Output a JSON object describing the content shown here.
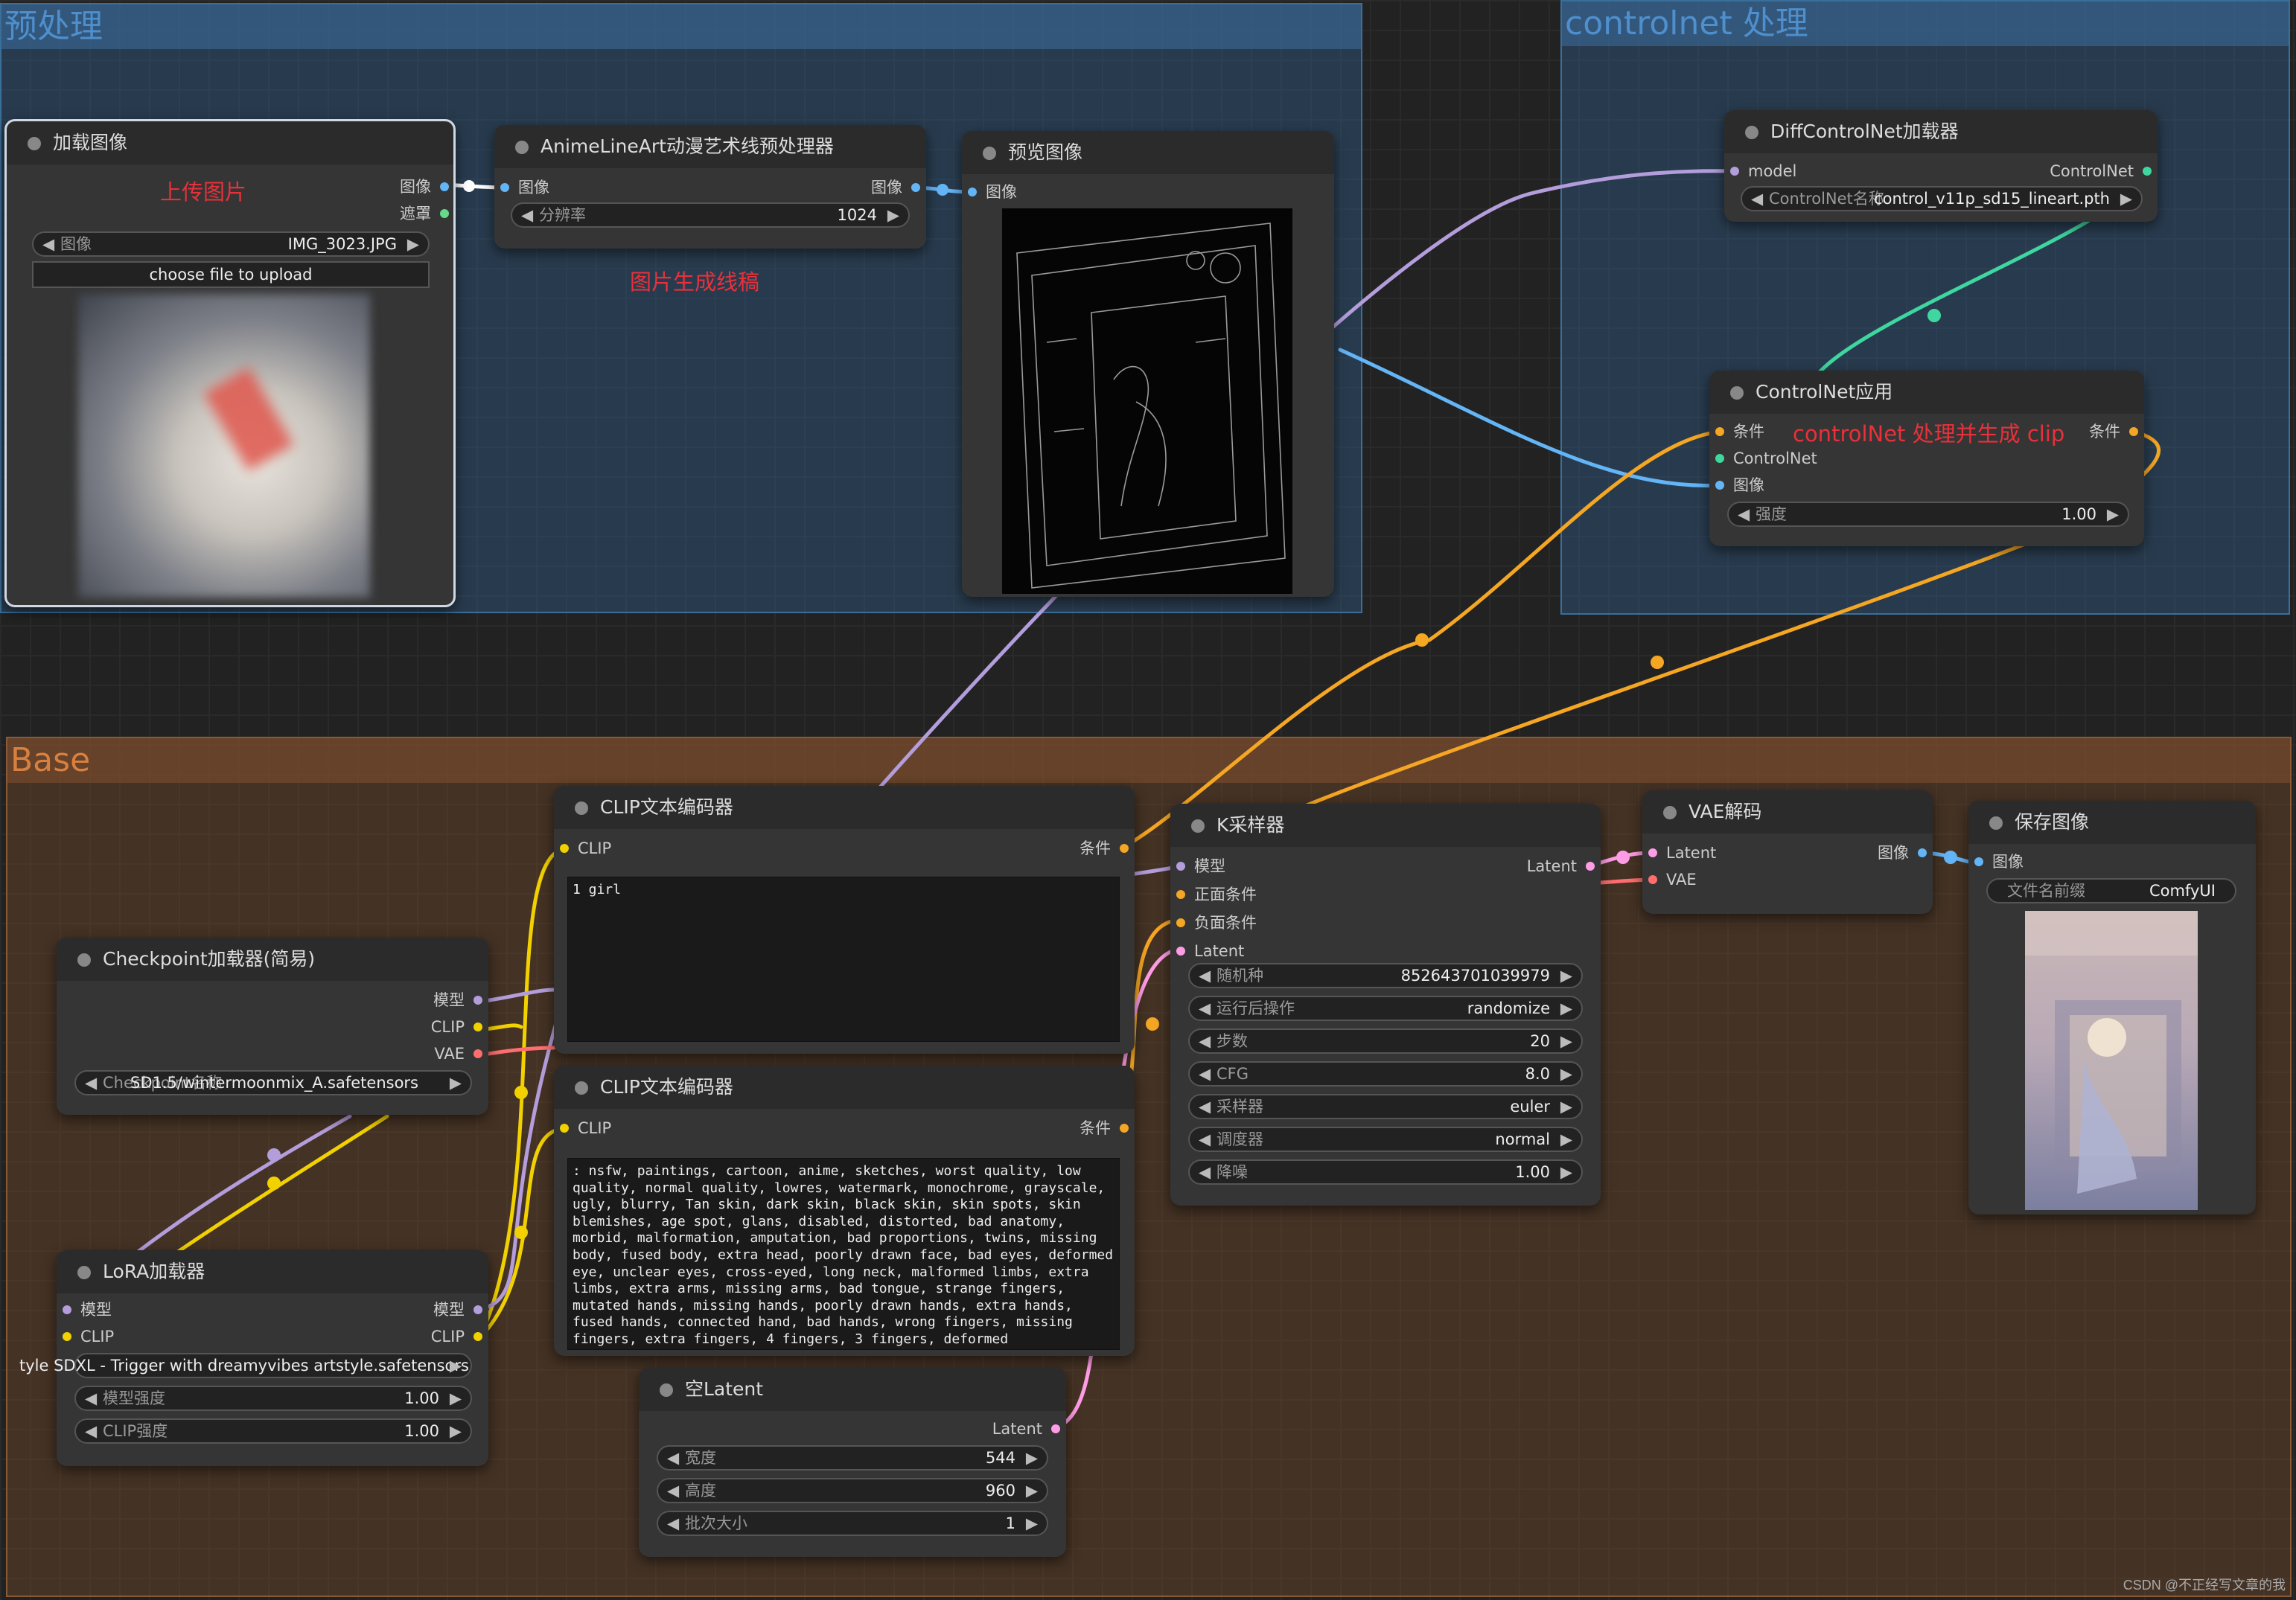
{
  "colors": {
    "clip": "#f2d100",
    "model": "#b39ddb",
    "conditioning": "#f5a623",
    "image": "#64b5f6",
    "latent": "#ff9ce6",
    "vae": "#ff6e6e",
    "controlnet": "#3fd6a0",
    "mask": "#66d98c",
    "red": "#e8313a"
  },
  "groups": {
    "preprocess": "预处理",
    "controlnet": "controlnet 处理",
    "base": "Base"
  },
  "load_image": {
    "title": "加载图像",
    "note": "上传图片",
    "out_image": "图像",
    "out_mask": "遮罩",
    "widget_label": "图像",
    "widget_value": "IMG_3023.JPG",
    "upload": "choose file to upload"
  },
  "anime": {
    "title": "AnimeLineArt动漫艺术线预处理器",
    "in_image": "图像",
    "out_image": "图像",
    "widget_label": "分辨率",
    "widget_value": "1024",
    "note": "图片生成线稿"
  },
  "preview": {
    "title": "预览图像",
    "in_image": "图像"
  },
  "diffcn": {
    "title": "DiffControlNet加载器",
    "in_model": "model",
    "out_cn": "ControlNet",
    "widget_label": "ControlNet名称",
    "widget_value": "control_v11p_sd15_lineart.pth"
  },
  "cnapply": {
    "title": "ControlNet应用",
    "in_cond": "条件",
    "in_cn": "ControlNet",
    "in_image": "图像",
    "out_cond": "条件",
    "note": "controlNet 处理并生成 clip",
    "widget_label": "强度",
    "widget_value": "1.00"
  },
  "clip1": {
    "title": "CLIP文本编码器",
    "in_clip": "CLIP",
    "out_cond": "条件",
    "text": "1 girl"
  },
  "clip2": {
    "title": "CLIP文本编码器",
    "in_clip": "CLIP",
    "out_cond": "条件",
    "text": ": nsfw, paintings, cartoon, anime, sketches, worst quality, low quality, normal quality, lowres, watermark, monochrome, grayscale, ugly, blurry, Tan skin, dark skin, black skin, skin spots, skin blemishes, age spot, glans, disabled, distorted, bad anatomy, morbid, malformation, amputation, bad proportions, twins, missing body, fused body, extra head, poorly drawn face, bad eyes, deformed eye, unclear eyes, cross-eyed, long neck, malformed limbs, extra limbs, extra arms, missing arms, bad tongue, strange fingers, mutated hands, missing hands, poorly drawn hands, extra hands, fused hands, connected hand, bad hands, wrong fingers, missing fingers, extra fingers, 4 fingers, 3 fingers, deformed"
  },
  "checkpoint": {
    "title": "Checkpoint加载器(简易)",
    "out_model": "模型",
    "out_clip": "CLIP",
    "out_vae": "VAE",
    "widget_label": "Checkpoint名称",
    "widget_value": "SD1.5/wintermoonmix_A.safetensors"
  },
  "lora": {
    "title": "LoRA加载器",
    "in_model": "模型",
    "in_clip": "CLIP",
    "out_model": "模型",
    "out_clip": "CLIP",
    "lora_overflow": "tyle SDXL - Trigger with dreamyvibes artstyle.safetensors",
    "w1_label": "模型强度",
    "w1_value": "1.00",
    "w2_label": "CLIP强度",
    "w2_value": "1.00"
  },
  "ksampler": {
    "title": "K采样器",
    "in_model": "模型",
    "in_pos": "正面条件",
    "in_neg": "负面条件",
    "in_latent": "Latent",
    "out_latent": "Latent",
    "widgets": [
      {
        "label": "随机种",
        "value": "852643701039979"
      },
      {
        "label": "运行后操作",
        "value": "randomize"
      },
      {
        "label": "步数",
        "value": "20"
      },
      {
        "label": "CFG",
        "value": "8.0"
      },
      {
        "label": "采样器",
        "value": "euler"
      },
      {
        "label": "调度器",
        "value": "normal"
      },
      {
        "label": "降噪",
        "value": "1.00"
      }
    ]
  },
  "vaedecode": {
    "title": "VAE解码",
    "in_latent": "Latent",
    "in_vae": "VAE",
    "out_image": "图像"
  },
  "save": {
    "title": "保存图像",
    "in_image": "图像",
    "widget_label": "文件名前缀",
    "widget_value": "ComfyUI"
  },
  "emptylatent": {
    "title": "空Latent",
    "out_latent": "Latent",
    "widgets": [
      {
        "label": "宽度",
        "value": "544"
      },
      {
        "label": "高度",
        "value": "960"
      },
      {
        "label": "批次大小",
        "value": "1"
      }
    ]
  },
  "watermark": "CSDN @不正经写文章的我"
}
